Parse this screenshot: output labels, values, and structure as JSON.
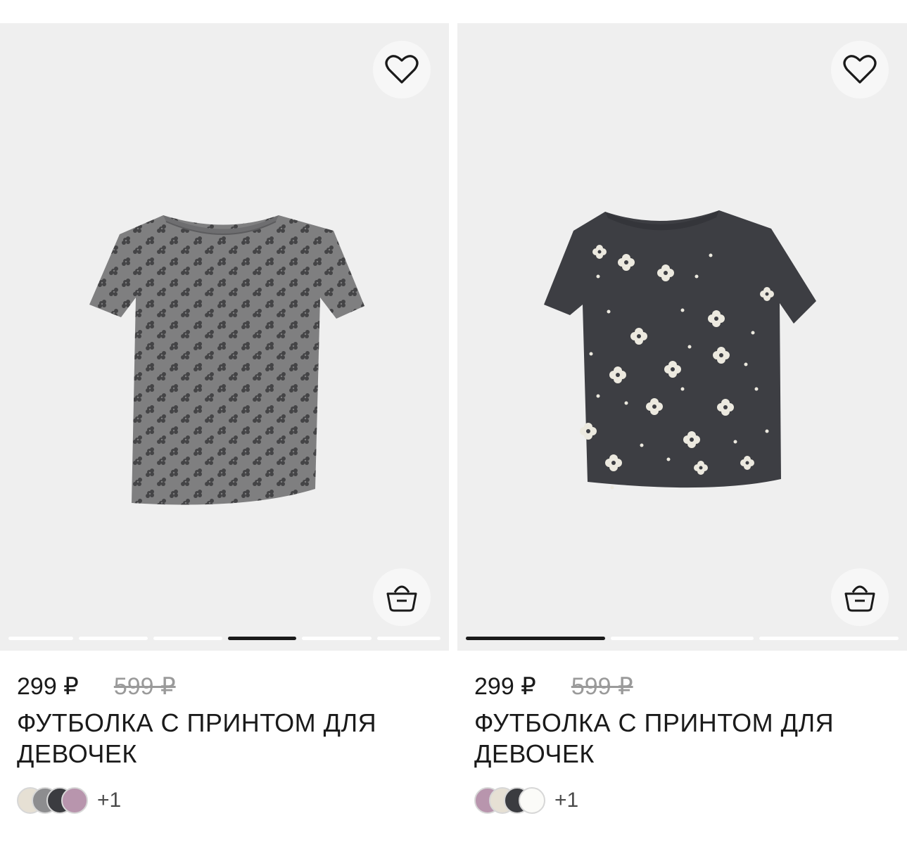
{
  "products": [
    {
      "price": "299 ₽",
      "old_price": "599 ₽",
      "title": "ФУТБОЛКА С ПРИНТОМ ДЛЯ ДЕВОЧЕК",
      "favorite_icon": "heart-outline-icon",
      "cart_icon": "basket-icon",
      "image_slides": 6,
      "active_slide": 4,
      "shirt_color": "#7f7f80",
      "print_color": "#3a3a3c",
      "swatches": [
        "#e6e0d4",
        "#8d8d8f",
        "#3b3c40",
        "#b895ad"
      ],
      "more_colors": "+1"
    },
    {
      "price": "299 ₽",
      "old_price": "599 ₽",
      "title": "ФУТБОЛКА С ПРИНТОМ ДЛЯ ДЕВОЧЕК",
      "favorite_icon": "heart-outline-icon",
      "cart_icon": "basket-icon",
      "image_slides": 3,
      "active_slide": 1,
      "shirt_color": "#3d3e43",
      "print_color": "#ece9df",
      "swatches": [
        "#b895ad",
        "#e6e0d4",
        "#3b3c40",
        "#fbfbf8"
      ],
      "more_colors": "+1"
    }
  ]
}
